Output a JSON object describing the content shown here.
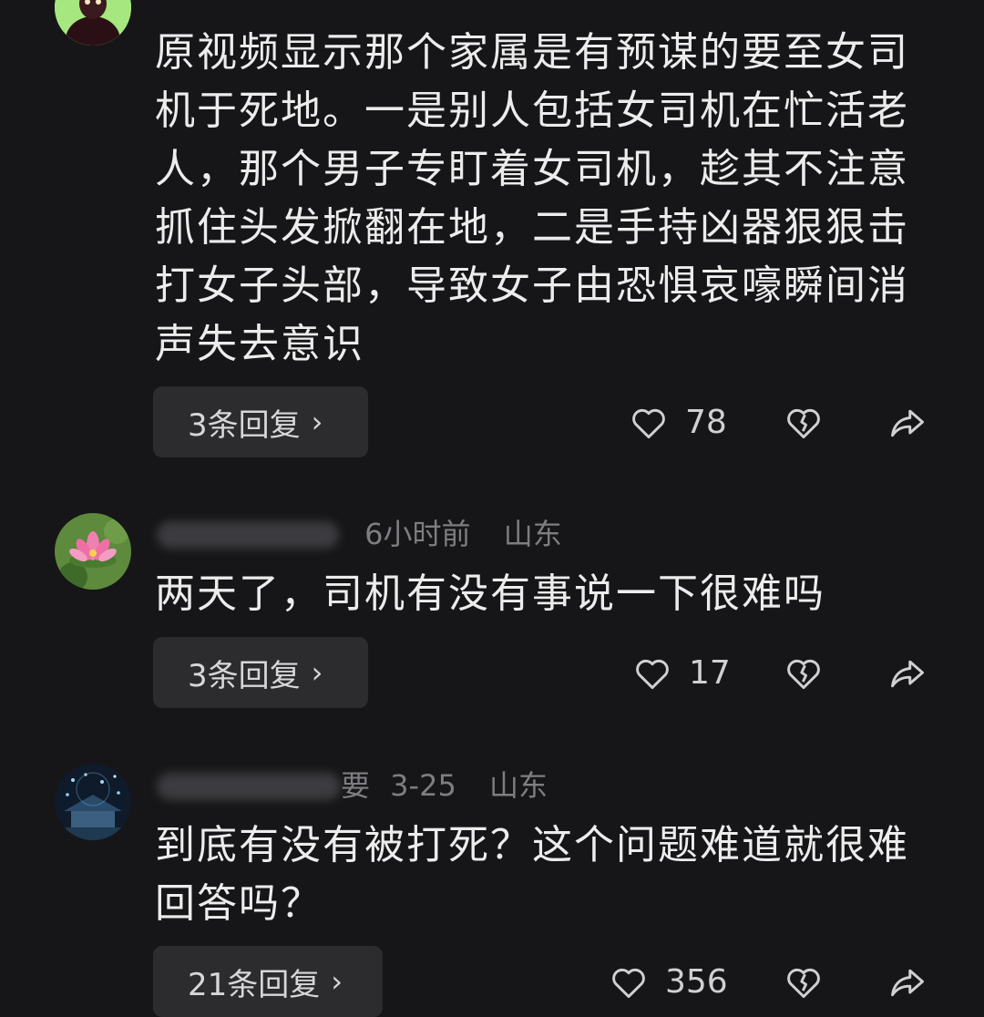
{
  "comments": [
    {
      "username": "",
      "time": "",
      "location": "",
      "text": "原视频显示那个家属是有预谋的要至女司机于死地。一是别人包括女司机在忙活老人，那个男子专盯着女司机，趁其不注意抓住头发掀翻在地，二是手持凶器狠狠击打女子头部，导致女子由恐惧哀嚎瞬间消声失去意识",
      "reply_label": "3条回复",
      "likes": "78",
      "avatar_icon": "dark-figure-avatar"
    },
    {
      "username": "",
      "time": "6小时前",
      "location": "山东",
      "text": "两天了，司机有没有事说一下很难吗",
      "reply_label": "3条回复",
      "likes": "17",
      "avatar_icon": "lotus-avatar"
    },
    {
      "username": "",
      "username_suffix": "要",
      "time": "3-25",
      "location": "山东",
      "text": "到底有没有被打死？这个问题难道就很难回答吗？",
      "reply_label": "21条回复",
      "likes": "356",
      "avatar_icon": "night-lights-avatar"
    }
  ],
  "icons": {
    "reply_chevron": "›",
    "like": "heart-outline-icon",
    "dislike": "broken-heart-icon",
    "share": "share-arrow-icon"
  },
  "colors": {
    "background": "#161618",
    "text": "#ececec",
    "meta": "#7d7d82",
    "button_bg": "#2c2c2f"
  }
}
